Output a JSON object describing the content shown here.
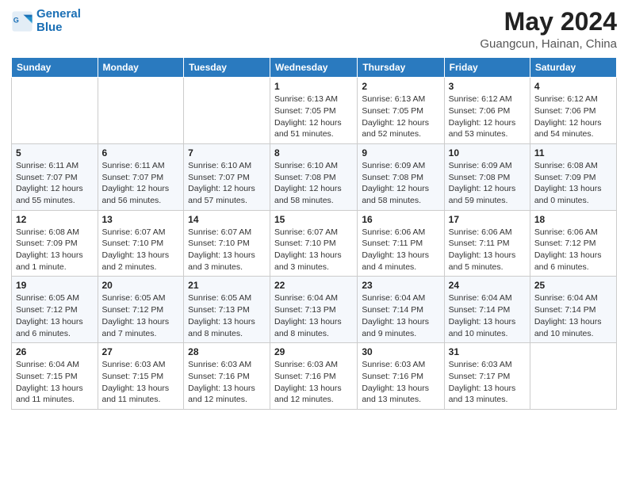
{
  "header": {
    "logo_line1": "General",
    "logo_line2": "Blue",
    "month": "May 2024",
    "location": "Guangcun, Hainan, China"
  },
  "weekdays": [
    "Sunday",
    "Monday",
    "Tuesday",
    "Wednesday",
    "Thursday",
    "Friday",
    "Saturday"
  ],
  "weeks": [
    [
      {
        "day": "",
        "info": ""
      },
      {
        "day": "",
        "info": ""
      },
      {
        "day": "",
        "info": ""
      },
      {
        "day": "1",
        "info": "Sunrise: 6:13 AM\nSunset: 7:05 PM\nDaylight: 12 hours\nand 51 minutes."
      },
      {
        "day": "2",
        "info": "Sunrise: 6:13 AM\nSunset: 7:05 PM\nDaylight: 12 hours\nand 52 minutes."
      },
      {
        "day": "3",
        "info": "Sunrise: 6:12 AM\nSunset: 7:06 PM\nDaylight: 12 hours\nand 53 minutes."
      },
      {
        "day": "4",
        "info": "Sunrise: 6:12 AM\nSunset: 7:06 PM\nDaylight: 12 hours\nand 54 minutes."
      }
    ],
    [
      {
        "day": "5",
        "info": "Sunrise: 6:11 AM\nSunset: 7:07 PM\nDaylight: 12 hours\nand 55 minutes."
      },
      {
        "day": "6",
        "info": "Sunrise: 6:11 AM\nSunset: 7:07 PM\nDaylight: 12 hours\nand 56 minutes."
      },
      {
        "day": "7",
        "info": "Sunrise: 6:10 AM\nSunset: 7:07 PM\nDaylight: 12 hours\nand 57 minutes."
      },
      {
        "day": "8",
        "info": "Sunrise: 6:10 AM\nSunset: 7:08 PM\nDaylight: 12 hours\nand 58 minutes."
      },
      {
        "day": "9",
        "info": "Sunrise: 6:09 AM\nSunset: 7:08 PM\nDaylight: 12 hours\nand 58 minutes."
      },
      {
        "day": "10",
        "info": "Sunrise: 6:09 AM\nSunset: 7:08 PM\nDaylight: 12 hours\nand 59 minutes."
      },
      {
        "day": "11",
        "info": "Sunrise: 6:08 AM\nSunset: 7:09 PM\nDaylight: 13 hours\nand 0 minutes."
      }
    ],
    [
      {
        "day": "12",
        "info": "Sunrise: 6:08 AM\nSunset: 7:09 PM\nDaylight: 13 hours\nand 1 minute."
      },
      {
        "day": "13",
        "info": "Sunrise: 6:07 AM\nSunset: 7:10 PM\nDaylight: 13 hours\nand 2 minutes."
      },
      {
        "day": "14",
        "info": "Sunrise: 6:07 AM\nSunset: 7:10 PM\nDaylight: 13 hours\nand 3 minutes."
      },
      {
        "day": "15",
        "info": "Sunrise: 6:07 AM\nSunset: 7:10 PM\nDaylight: 13 hours\nand 3 minutes."
      },
      {
        "day": "16",
        "info": "Sunrise: 6:06 AM\nSunset: 7:11 PM\nDaylight: 13 hours\nand 4 minutes."
      },
      {
        "day": "17",
        "info": "Sunrise: 6:06 AM\nSunset: 7:11 PM\nDaylight: 13 hours\nand 5 minutes."
      },
      {
        "day": "18",
        "info": "Sunrise: 6:06 AM\nSunset: 7:12 PM\nDaylight: 13 hours\nand 6 minutes."
      }
    ],
    [
      {
        "day": "19",
        "info": "Sunrise: 6:05 AM\nSunset: 7:12 PM\nDaylight: 13 hours\nand 6 minutes."
      },
      {
        "day": "20",
        "info": "Sunrise: 6:05 AM\nSunset: 7:12 PM\nDaylight: 13 hours\nand 7 minutes."
      },
      {
        "day": "21",
        "info": "Sunrise: 6:05 AM\nSunset: 7:13 PM\nDaylight: 13 hours\nand 8 minutes."
      },
      {
        "day": "22",
        "info": "Sunrise: 6:04 AM\nSunset: 7:13 PM\nDaylight: 13 hours\nand 8 minutes."
      },
      {
        "day": "23",
        "info": "Sunrise: 6:04 AM\nSunset: 7:14 PM\nDaylight: 13 hours\nand 9 minutes."
      },
      {
        "day": "24",
        "info": "Sunrise: 6:04 AM\nSunset: 7:14 PM\nDaylight: 13 hours\nand 10 minutes."
      },
      {
        "day": "25",
        "info": "Sunrise: 6:04 AM\nSunset: 7:14 PM\nDaylight: 13 hours\nand 10 minutes."
      }
    ],
    [
      {
        "day": "26",
        "info": "Sunrise: 6:04 AM\nSunset: 7:15 PM\nDaylight: 13 hours\nand 11 minutes."
      },
      {
        "day": "27",
        "info": "Sunrise: 6:03 AM\nSunset: 7:15 PM\nDaylight: 13 hours\nand 11 minutes."
      },
      {
        "day": "28",
        "info": "Sunrise: 6:03 AM\nSunset: 7:16 PM\nDaylight: 13 hours\nand 12 minutes."
      },
      {
        "day": "29",
        "info": "Sunrise: 6:03 AM\nSunset: 7:16 PM\nDaylight: 13 hours\nand 12 minutes."
      },
      {
        "day": "30",
        "info": "Sunrise: 6:03 AM\nSunset: 7:16 PM\nDaylight: 13 hours\nand 13 minutes."
      },
      {
        "day": "31",
        "info": "Sunrise: 6:03 AM\nSunset: 7:17 PM\nDaylight: 13 hours\nand 13 minutes."
      },
      {
        "day": "",
        "info": ""
      }
    ]
  ]
}
